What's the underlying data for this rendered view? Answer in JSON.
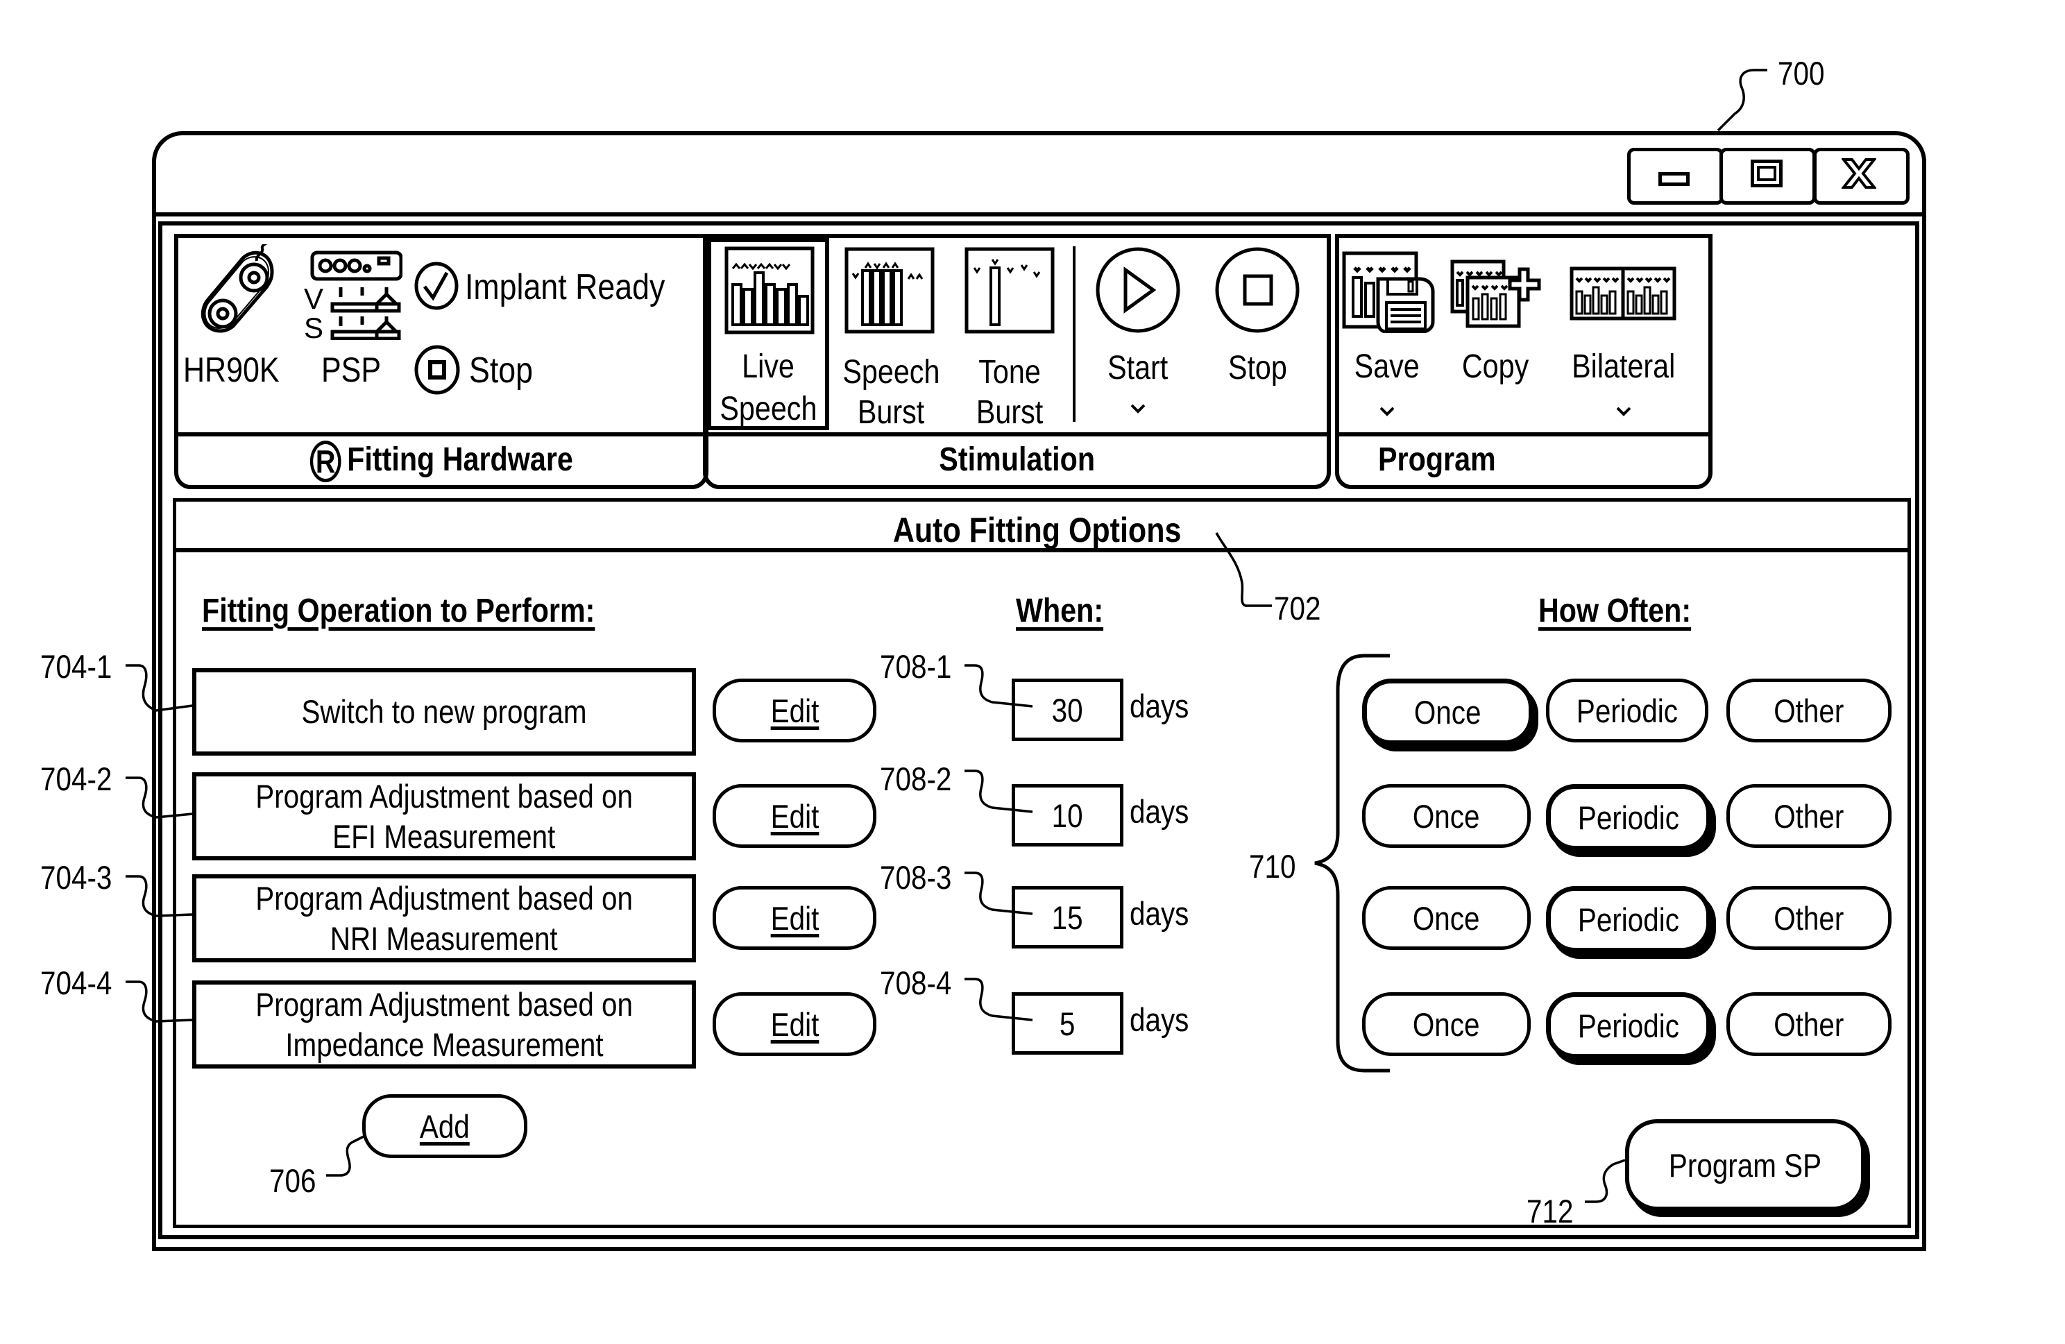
{
  "figure_refs": {
    "window": "700",
    "auto_fitting_options": "702",
    "operations": [
      "704-1",
      "704-2",
      "704-3",
      "704-4"
    ],
    "add": "706",
    "when_fields": [
      "708-1",
      "708-2",
      "708-3",
      "708-4"
    ],
    "how_often_group": "710",
    "program_sp": "712"
  },
  "window_controls": {
    "minimize_icon": "minimize-icon",
    "maximize_icon": "maximize-icon",
    "close_icon": "close-icon"
  },
  "toolbar": {
    "fitting_hardware": {
      "label": "Fitting Hardware",
      "label_icon": "registered-circle-r-icon",
      "items": [
        {
          "label": "HR90K",
          "icon": "implant-icon"
        },
        {
          "label": "PSP",
          "icon": "processor-icon"
        }
      ],
      "psp_icon_letters": [
        "V",
        "S"
      ],
      "status": [
        {
          "label": "Implant Ready",
          "icon": "check-circle-icon"
        },
        {
          "label": "Stop",
          "icon": "stop-circle-icon"
        }
      ]
    },
    "stimulation": {
      "label": "Stimulation",
      "items": [
        {
          "label_line1": "Live",
          "label_line2": "Speech",
          "icon": "live-speech-icon",
          "selected": true
        },
        {
          "label_line1": "Speech",
          "label_line2": "Burst",
          "icon": "speech-burst-icon",
          "selected": false
        },
        {
          "label_line1": "Tone",
          "label_line2": "Burst",
          "icon": "tone-burst-icon",
          "selected": false
        }
      ],
      "controls": [
        {
          "label": "Start",
          "icon": "play-circle-icon",
          "has_dropdown": true,
          "dropdown_glyph": "⌄"
        },
        {
          "label": "Stop",
          "icon": "stop-circle-icon",
          "has_dropdown": false
        }
      ]
    },
    "program": {
      "label": "Program",
      "items": [
        {
          "label": "Save",
          "icon": "save-program-icon",
          "has_dropdown": true,
          "dropdown_glyph": "⌄"
        },
        {
          "label": "Copy",
          "icon": "copy-program-icon",
          "has_dropdown": false
        },
        {
          "label": "Bilateral",
          "icon": "bilateral-program-icon",
          "has_dropdown": true,
          "dropdown_glyph": "⌄"
        }
      ]
    }
  },
  "auto_fitting": {
    "title": "Auto Fitting Options",
    "headers": {
      "operation": "Fitting Operation to Perform:",
      "when": "When:",
      "how_often": "How Often:"
    },
    "edit_label": "Edit",
    "unit_label": "days",
    "frequency_options": [
      "Once",
      "Periodic",
      "Other"
    ],
    "rows": [
      {
        "operation_line1": "Switch to new program",
        "operation_line2": "",
        "when_value": "30",
        "how_often_selected": "Once"
      },
      {
        "operation_line1": "Program Adjustment based on",
        "operation_line2": "EFI Measurement",
        "when_value": "10",
        "how_often_selected": "Periodic"
      },
      {
        "operation_line1": "Program Adjustment based on",
        "operation_line2": "NRI Measurement",
        "when_value": "15",
        "how_often_selected": "Periodic"
      },
      {
        "operation_line1": "Program Adjustment based on",
        "operation_line2": "Impedance Measurement",
        "when_value": "5",
        "how_often_selected": "Periodic"
      }
    ],
    "add_label": "Add",
    "program_sp_label": "Program SP"
  }
}
